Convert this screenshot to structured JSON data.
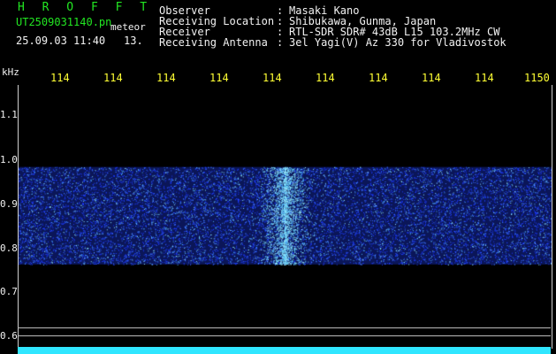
{
  "header": {
    "app_title": "H R O F F T",
    "file_name": "UT2509031140.pn",
    "meteor_label": "meteor",
    "date_time": "25.09.03 11:40",
    "count_value": "13."
  },
  "metadata": [
    {
      "label": "Observer",
      "colon": ":",
      "value": "Masaki Kano"
    },
    {
      "label": "Receiving Location",
      "colon": ":",
      "value": "Shibukawa, Gunma, Japan"
    },
    {
      "label": "Receiver",
      "colon": ":",
      "value": "RTL-SDR SDR# 43dB L15 103.2MHz CW"
    },
    {
      "label": "Receiving Antenna",
      "colon": ":",
      "value": "3el Yagi(V) Az 330 for Vladivostok"
    }
  ],
  "axis": {
    "unit_label": "kHz",
    "y_ticks": [
      "1.1",
      "1.0",
      "0.9",
      "0.8",
      "0.7",
      "0.6"
    ],
    "x_ticks": [
      "114",
      "114",
      "114",
      "114",
      "114",
      "114",
      "114",
      "114",
      "114",
      "1150"
    ]
  },
  "colors": {
    "background": "#000000",
    "header_green": "#22e622",
    "tick_yellow": "#ffff33",
    "signal_blue": "#1e3cff",
    "signal_cyan": "#30e6ff"
  },
  "waterfall": {
    "band_frequency_khz": [
      0.785,
      1.005
    ],
    "meteor_trace_time_fraction": 0.5
  }
}
